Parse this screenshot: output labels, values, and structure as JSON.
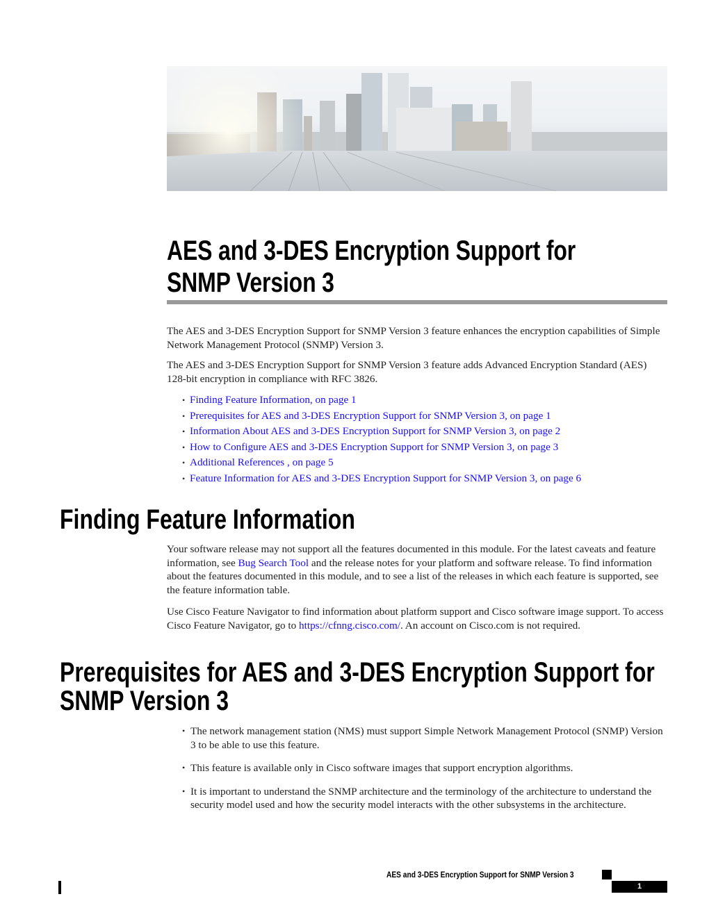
{
  "hero_image": {
    "alt": "city skyline across a bridge"
  },
  "title": "AES and 3-DES Encryption Support for SNMP Version 3",
  "intro": [
    "The AES and 3-DES Encryption Support for SNMP Version 3 feature enhances the encryption capabilities of Simple Network Management Protocol (SNMP) Version 3.",
    "The AES and 3-DES Encryption Support for SNMP Version 3 feature adds Advanced Encryption Standard (AES) 128-bit encryption in compliance with RFC 3826."
  ],
  "toc": [
    "Finding Feature Information, on page 1",
    "Prerequisites for AES and 3-DES Encryption Support for SNMP Version 3, on page 1",
    "Information About AES and 3-DES Encryption Support for SNMP Version 3, on page 2",
    "How to Configure AES and 3-DES Encryption Support for SNMP Version 3, on page 3",
    "Additional References , on page 5",
    "Feature Information for AES and 3-DES Encryption Support for SNMP Version 3, on page 6"
  ],
  "finding": {
    "heading": "Finding Feature Information",
    "p1_before": "Your software release may not support all the features documented in this module. For the latest caveats and feature information, see ",
    "p1_link": "Bug Search Tool",
    "p1_after": " and the release notes for your platform and software release. To find information about the features documented in this module, and to see a list of the releases in which each feature is supported, see the feature information table.",
    "p2_before": "Use Cisco Feature Navigator to find information about platform support and Cisco software image support. To access Cisco Feature Navigator, go to ",
    "p2_link": "https://cfnng.cisco.com/",
    "p2_after": ". An account on Cisco.com is not required."
  },
  "prereq": {
    "heading": "Prerequisites for AES and 3-DES Encryption Support for SNMP Version 3",
    "items": [
      "The network management station (NMS) must support Simple Network Management Protocol (SNMP) Version 3 to be able to use this feature.",
      "This feature is available only in Cisco software images that support encryption algorithms.",
      "It is important to understand the SNMP architecture and the terminology of the architecture to understand the security model used and how the security model interacts with the other subsystems in the architecture."
    ]
  },
  "footer": {
    "title": "AES and 3-DES Encryption Support for SNMP Version 3",
    "page": "1"
  }
}
